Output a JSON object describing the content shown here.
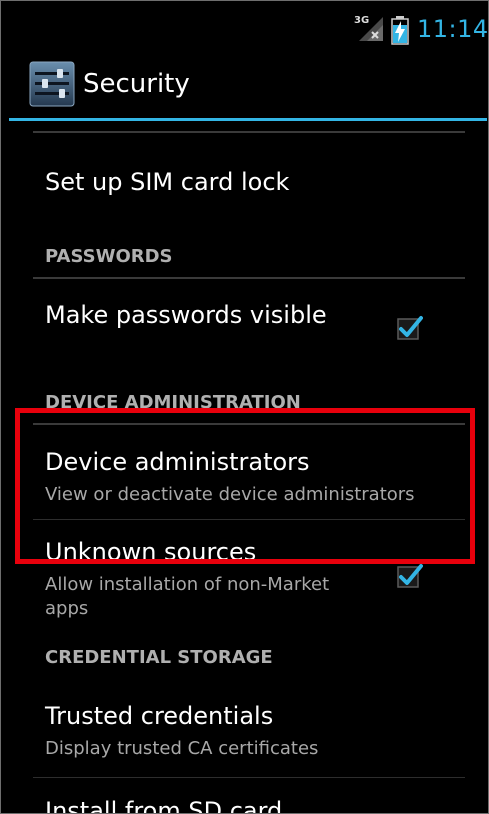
{
  "status_bar": {
    "network_type": "3G",
    "time": "11:14"
  },
  "action_bar": {
    "title": "Security",
    "icon": "settings-sliders-icon"
  },
  "items": {
    "sim_lock": {
      "title": "Set up SIM card lock"
    },
    "passwords_header": "PASSWORDS",
    "make_passwords_visible": {
      "title": "Make passwords visible",
      "checked": true
    },
    "device_admin_header": "DEVICE ADMINISTRATION",
    "device_administrators": {
      "title": "Device administrators",
      "summary": "View or deactivate device administrators"
    },
    "unknown_sources": {
      "title": "Unknown sources",
      "summary_line1": "Allow installation of non-Market",
      "summary_line2": "apps",
      "checked": true
    },
    "credential_storage_header": "CREDENTIAL STORAGE",
    "trusted_credentials": {
      "title": "Trusted credentials",
      "summary": "Display trusted CA certificates"
    },
    "install_from_sd": {
      "title": "Install from SD card"
    }
  },
  "colors": {
    "accent": "#33b5e5",
    "highlight": "#e8000c",
    "checkmark": "#33b5e5"
  }
}
